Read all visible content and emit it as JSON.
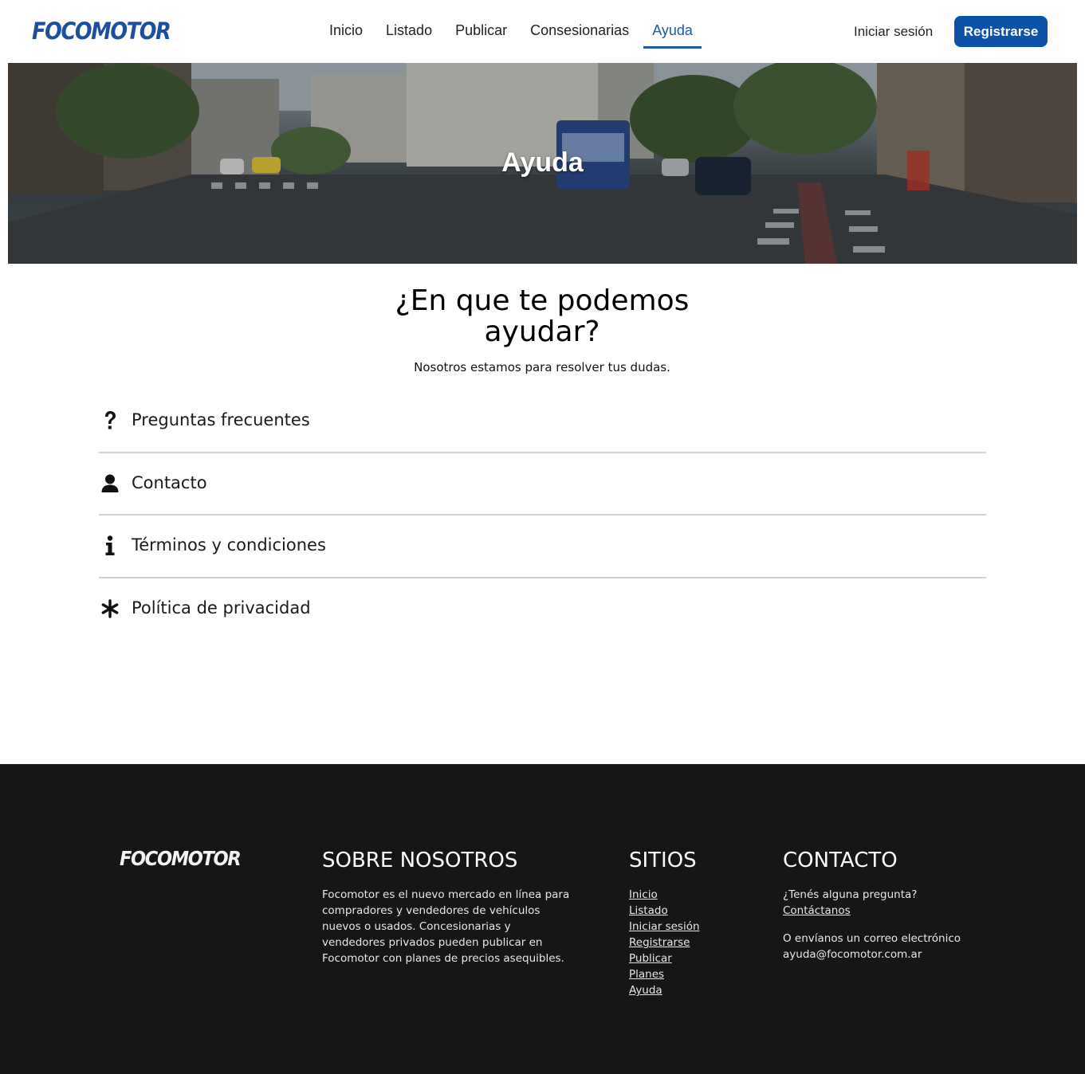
{
  "header": {
    "logo": "FOCOMOTOR",
    "nav": [
      {
        "label": "Inicio"
      },
      {
        "label": "Listado"
      },
      {
        "label": "Publicar"
      },
      {
        "label": "Consesionarias"
      },
      {
        "label": "Ayuda",
        "active": true
      }
    ],
    "login_label": "Iniciar sesión",
    "register_label": "Registrarse"
  },
  "hero": {
    "title": "Ayuda"
  },
  "main": {
    "title": "¿En que te podemos ayudar?",
    "subtitle": "Nosotros estamos para resolver tus dudas.",
    "items": [
      {
        "label": "Preguntas frecuentes",
        "icon": "question-icon"
      },
      {
        "label": "Contacto",
        "icon": "user-icon"
      },
      {
        "label": "Términos y condiciones",
        "icon": "info-icon"
      },
      {
        "label": "Política de privacidad",
        "icon": "asterisk-icon"
      }
    ]
  },
  "footer": {
    "logo": "FOCOMOTOR",
    "about": {
      "title": "SOBRE NOSOTROS",
      "text": "Focomotor es el nuevo mercado en línea para compradores y vendedores de vehículos nuevos o usados. Concesionarias y vendedores privados pueden publicar en Focomotor con planes de precios asequibles."
    },
    "sites": {
      "title": "SITIOS",
      "links": [
        "Inicio",
        "Listado",
        "Iniciar sesión",
        "Registrarse",
        "Publicar",
        "Planes",
        "Ayuda"
      ]
    },
    "contact": {
      "title": "CONTACTO",
      "question": "¿Tenés alguna pregunta?",
      "link": "Contáctanos",
      "email_text": "O envíanos un correo electrónico",
      "email": "ayuda@focomotor.com.ar"
    }
  },
  "colors": {
    "brand_blue": "#0c52a8",
    "footer_bg": "#161616"
  }
}
